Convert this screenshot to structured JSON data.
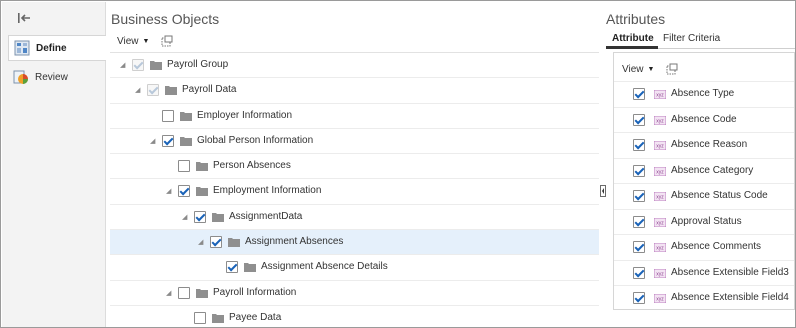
{
  "nav": {
    "items": [
      {
        "label": "Define",
        "icon": "define-icon",
        "active": true
      },
      {
        "label": "Review",
        "icon": "review-icon",
        "active": false
      }
    ]
  },
  "business_objects": {
    "title": "Business Objects",
    "view_label": "View",
    "rows": [
      {
        "label": "Payroll Group",
        "checked": true,
        "disabled": true,
        "expanded": true,
        "selected": false
      },
      {
        "label": "Payroll Data",
        "checked": true,
        "disabled": true,
        "expanded": true,
        "selected": false
      },
      {
        "label": "Employer Information",
        "checked": false,
        "disabled": false,
        "expanded": false,
        "selected": false
      },
      {
        "label": "Global Person Information",
        "checked": true,
        "disabled": false,
        "expanded": true,
        "selected": false
      },
      {
        "label": "Person Absences",
        "checked": false,
        "disabled": false,
        "expanded": false,
        "selected": false
      },
      {
        "label": "Employment Information",
        "checked": true,
        "disabled": false,
        "expanded": true,
        "selected": false
      },
      {
        "label": "AssignmentData",
        "checked": true,
        "disabled": false,
        "expanded": true,
        "selected": false
      },
      {
        "label": "Assignment Absences",
        "checked": true,
        "disabled": false,
        "expanded": true,
        "selected": true
      },
      {
        "label": "Assignment Absence Details",
        "checked": true,
        "disabled": false,
        "expanded": false,
        "selected": false
      },
      {
        "label": "Payroll Information",
        "checked": false,
        "disabled": false,
        "expanded": true,
        "selected": false
      },
      {
        "label": "Payee Data",
        "checked": false,
        "disabled": false,
        "expanded": false,
        "selected": false
      }
    ]
  },
  "attributes": {
    "title": "Attributes",
    "tabs": [
      {
        "label": "Attribute",
        "active": true
      },
      {
        "label": "Filter Criteria",
        "active": false
      }
    ],
    "view_label": "View",
    "type_icon_text": "xyz",
    "items": [
      {
        "label": "Absence Type",
        "checked": true
      },
      {
        "label": "Absence Code",
        "checked": true
      },
      {
        "label": "Absence Reason",
        "checked": true
      },
      {
        "label": "Absence Category",
        "checked": true
      },
      {
        "label": "Absence Status Code",
        "checked": true
      },
      {
        "label": "Approval Status",
        "checked": true
      },
      {
        "label": "Absence Comments",
        "checked": true
      },
      {
        "label": "Absence Extensible Field3",
        "checked": true
      },
      {
        "label": "Absence Extensible Field4",
        "checked": true
      }
    ]
  },
  "colors": {
    "check": "#1a63b8",
    "selected_row": "#e5f0fb",
    "folder": "#8f8f8f",
    "type_icon": "#b06ab3"
  }
}
